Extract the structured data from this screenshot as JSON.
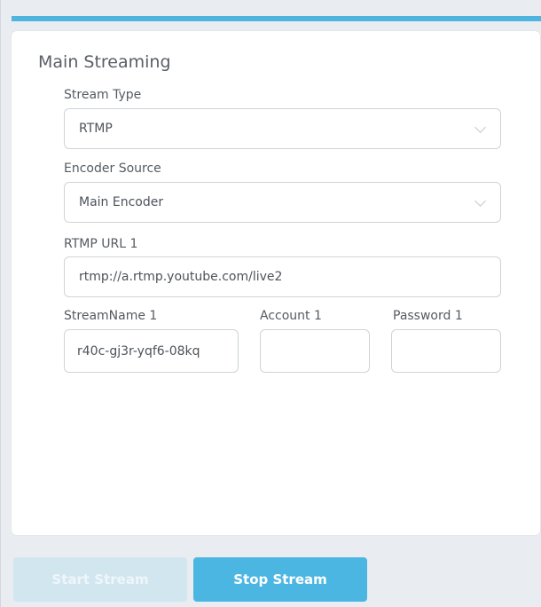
{
  "panel": {
    "title": "Main Streaming"
  },
  "stream_type": {
    "label": "Stream Type",
    "value": "RTMP"
  },
  "encoder_source": {
    "label": "Encoder Source",
    "value": "Main Encoder"
  },
  "rtmp_url": {
    "label": "RTMP URL 1",
    "value": "rtmp://a.rtmp.youtube.com/live2"
  },
  "stream_name": {
    "label": "StreamName 1",
    "value": "r40c-gj3r-yqf6-08kq"
  },
  "account": {
    "label": "Account 1",
    "value": ""
  },
  "password": {
    "label": "Password 1",
    "value": ""
  },
  "buttons": {
    "start_label": "Start Stream",
    "stop_label": "Stop Stream",
    "start_enabled": false,
    "stop_enabled": true
  },
  "colors": {
    "accent": "#4fb5de",
    "button_active": "#4cb6e2",
    "button_disabled": "#d2e6f0"
  },
  "icons": {
    "dropdown": "chevron-down-icon"
  }
}
